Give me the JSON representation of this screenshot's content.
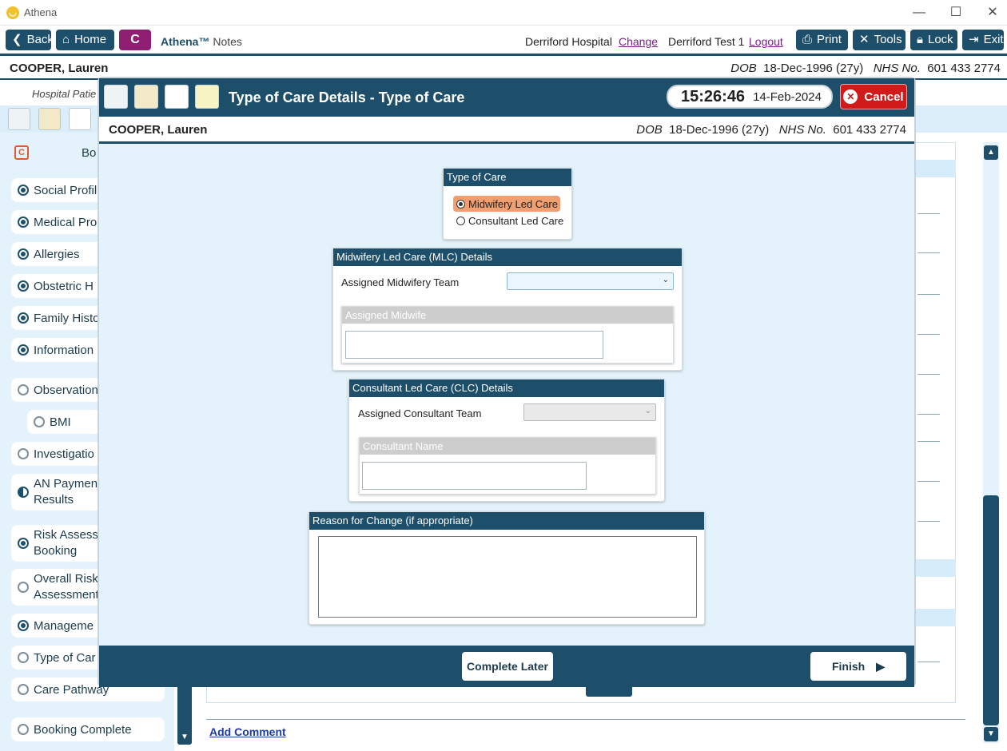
{
  "window": {
    "title": "Athena",
    "minimize": "—",
    "maximize": "☐",
    "close": "✕"
  },
  "toolbar": {
    "back": "Back",
    "home": "Home",
    "c_button": "C",
    "brand_name": "Athena™",
    "brand_suffix": "Notes",
    "hospital": "Derriford Hospital",
    "change": "Change",
    "user": "Derriford Test 1",
    "logout": "Logout",
    "print": "Print",
    "tools": "Tools",
    "lock": "Lock",
    "exit": "Exit"
  },
  "patient": {
    "name": "COOPER, Lauren",
    "dob_label": "DOB",
    "dob": "18-Dec-1996 (27y)",
    "nhs_label": "NHS No.",
    "nhs": "601 433 2774"
  },
  "subbar": {
    "text": "Hospital Patie"
  },
  "sidebar": {
    "header": "Bo",
    "items": [
      {
        "label": "Social Profil",
        "state": "on"
      },
      {
        "label": "Medical Pro",
        "state": "on"
      },
      {
        "label": "Allergies",
        "state": "on"
      },
      {
        "label": "Obstetric H",
        "state": "on"
      },
      {
        "label": "Family Histo",
        "state": "on"
      },
      {
        "label": "Information",
        "state": "on"
      },
      {
        "label": "Observation",
        "state": "off"
      },
      {
        "label": "BMI",
        "state": "off"
      },
      {
        "label": "Investigatio",
        "state": "off"
      },
      {
        "label": "AN Paymen",
        "label2": "Results",
        "state": "half"
      },
      {
        "label": "Risk Assess",
        "label2": "Booking",
        "state": "on"
      },
      {
        "label": "Overall Risk",
        "label2": "Assessment",
        "state": "off"
      },
      {
        "label": "Manageme",
        "state": "on"
      },
      {
        "label": "Type of Car",
        "state": "off"
      },
      {
        "label": "Care Pathway",
        "state": "off"
      },
      {
        "label": "Booking Complete",
        "state": "off"
      }
    ]
  },
  "add_comment": "Add Comment",
  "modal": {
    "title": "Type of Care Details - Type of Care",
    "time": "15:26:46",
    "date": "14-Feb-2024",
    "cancel": "Cancel",
    "type_of_care": {
      "header": "Type of Care",
      "options": [
        {
          "label": "Midwifery Led Care",
          "selected": true
        },
        {
          "label": "Consultant Led Care",
          "selected": false
        }
      ]
    },
    "mlc": {
      "header": "Midwifery Led Care (MLC) Details",
      "team_label": "Assigned Midwifery Team",
      "team_value": "",
      "midwife_header": "Assigned Midwife",
      "midwife_value": ""
    },
    "clc": {
      "header": "Consultant Led Care (CLC) Details",
      "team_label": "Assigned Consultant Team",
      "team_value": "",
      "name_header": "Consultant Name",
      "name_value": ""
    },
    "reason": {
      "header": "Reason for Change (if appropriate)",
      "value": ""
    },
    "complete_later": "Complete Later",
    "finish": "Finish"
  },
  "colors": {
    "primary": "#1d4f6b",
    "accent_selected": "#f0a070",
    "cancel": "#d11b1b",
    "brand_c": "#8e1f73"
  }
}
